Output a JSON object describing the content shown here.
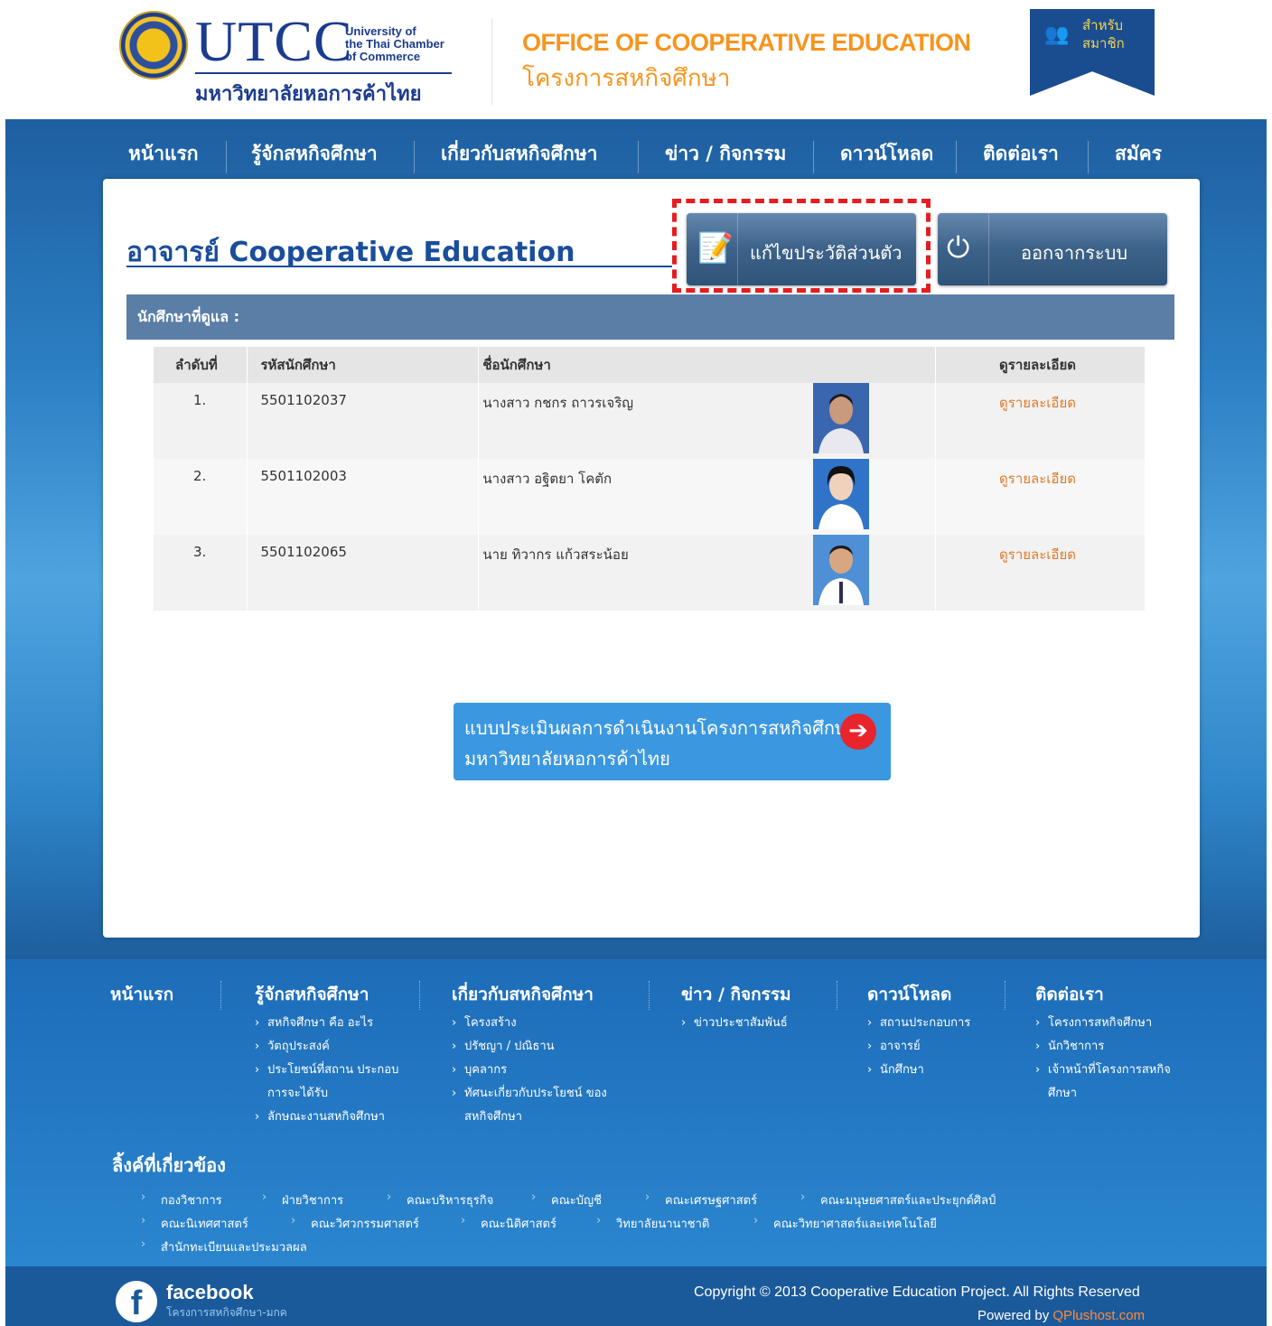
{
  "header": {
    "logo_text": "UTCC",
    "logo_sub": "University of the Thai Chamber of Commerce",
    "logo_thai": "มหาวิทยาลัยหอการค้าไทย",
    "office_en": "OFFICE OF COOPERATIVE EDUCATION",
    "office_th": "โครงการสหกิจศึกษา",
    "member_label": "สำหรับ สมาชิก"
  },
  "nav": {
    "items": [
      "หน้าแรก",
      "รู้จักสหกิจศึกษา",
      "เกี่ยวกับสหกิจศึกษา",
      "ข่าว / กิจกรรม",
      "ดาวน์โหลด",
      "ติดต่อเรา",
      "สมัคร"
    ]
  },
  "main": {
    "title": "อาจารย์ Cooperative Education",
    "edit_profile_label": "แก้ไขประวัติส่วนตัว",
    "logout_label": "ออกจากระบบ",
    "section_title": "นักศึกษาที่ดูแล :",
    "table": {
      "headers": [
        "ลำดับที่",
        "รหัสนักศึกษา",
        "ชื่อนักศึกษา",
        "ดูรายละเอียด"
      ],
      "rows": [
        {
          "no": "1.",
          "id": "5501102037",
          "name": "นางสาว กชกร ถาวรเจริญ",
          "detail": "ดูรายละเอียด"
        },
        {
          "no": "2.",
          "id": "5501102003",
          "name": "นางสาว อฐิตยา โคตัก",
          "detail": "ดูรายละเอียด"
        },
        {
          "no": "3.",
          "id": "5501102065",
          "name": "นาย ทิวากร แก้วสระน้อย",
          "detail": "ดูรายละเอียด"
        }
      ]
    },
    "assessment_line1": "แบบประเมินผลการดำเนินงานโครงการสหกิจศึกษา",
    "assessment_line2": "มหาวิทยาลัยหอการค้าไทย"
  },
  "footer": {
    "columns": [
      {
        "heading": "หน้าแรก",
        "links": []
      },
      {
        "heading": "รู้จักสหกิจศึกษา",
        "links": [
          "สหกิจศึกษา คือ อะไร",
          "วัตถุประสงค์",
          "ประโยชน์ที่สถาน ประกอบการจะได้รับ",
          "ลักษณะงานสหกิจศึกษา"
        ]
      },
      {
        "heading": "เกี่ยวกับสหกิจศึกษา",
        "links": [
          "โครงสร้าง",
          "ปรัชญา / ปณิธาน",
          "บุคลากร",
          "ทัศนะเกี่ยวกับประโยชน์ ของสหกิจศึกษา"
        ]
      },
      {
        "heading": "ข่าว / กิจกรรม",
        "links": [
          "ข่าวประชาสัมพันธ์"
        ]
      },
      {
        "heading": "ดาวน์โหลด",
        "links": [
          "สถานประกอบการ",
          "อาจารย์",
          "นักศึกษา"
        ]
      },
      {
        "heading": "ติดต่อเรา",
        "links": [
          "โครงการสหกิจศึกษา",
          "นักวิชาการ",
          "เจ้าหน้าที่โครงการสหกิจ ศึกษา"
        ]
      }
    ],
    "related_heading": "ลิ้งค์ที่เกี่ยวข้อง",
    "related_links": [
      "กองวิชาการ",
      "ฝ่ายวิชาการ",
      "คณะบริหารธุรกิจ",
      "คณะบัญชี",
      "คณะเศรษฐศาสตร์",
      "คณะมนุษยศาสตร์และประยุกต์ศิลป์",
      "คณะนิเทศศาสตร์",
      "คณะวิศวกรรมศาสตร์",
      "คณะนิติศาสตร์",
      "วิทยาลัยนานาชาติ",
      "คณะวิทยาศาสตร์และเทคโนโลยี",
      "สำนักทะเบียนและประมวลผล"
    ],
    "facebook_label": "facebook",
    "facebook_sub": "โครงการสหกิจศึกษา-มกค",
    "copyright": "Copyright © 2013 Cooperative Education Project. All Rights Reserved",
    "powered_label": "Powered by",
    "powered_host": "QPlushost.com"
  }
}
